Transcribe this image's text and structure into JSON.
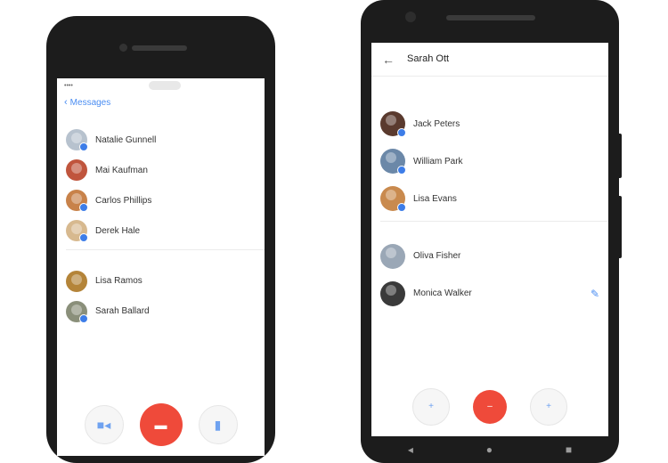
{
  "left_phone": {
    "status": {
      "carrier": "•••• ",
      "time": "",
      "battery": ""
    },
    "nav": {
      "back_label": "Messages"
    },
    "sections": [
      {
        "label": "",
        "items": [
          {
            "name": "Natalie Gunnell",
            "color": "#b7c2ce"
          },
          {
            "name": "Mai Kaufman",
            "color": "#c0553d"
          },
          {
            "name": "Carlos Phillips",
            "color": "#c8824a"
          },
          {
            "name": "Derek Hale",
            "color": "#d7b98f"
          }
        ]
      },
      {
        "label": "",
        "items": [
          {
            "name": "Lisa Ramos",
            "sub": "",
            "color": "#b48439"
          },
          {
            "name": "Sarah Ballard",
            "sub": "",
            "color": "#8a8f7a"
          }
        ]
      }
    ],
    "controls": [
      "video-icon",
      "end-call-icon",
      "mic-icon"
    ]
  },
  "right_phone": {
    "appbar": {
      "title": "Sarah Ott",
      "subtitle": ""
    },
    "sections": [
      {
        "label": "",
        "items": [
          {
            "name": "Jack Peters",
            "color": "#5a3a2e"
          },
          {
            "name": "William Park",
            "color": "#6b88a8"
          },
          {
            "name": "Lisa Evans",
            "color": "#c98a4e"
          }
        ]
      },
      {
        "label": "",
        "items": [
          {
            "name": "Oliva Fisher",
            "sub": "",
            "color": "#9aa7b6"
          },
          {
            "name": "Monica Walker",
            "sub": "",
            "color": "#3a3a3a"
          }
        ]
      }
    ],
    "controls": [
      "add-icon",
      "end-call-icon",
      "add-icon"
    ]
  },
  "colors": {
    "accent": "#4a8df2",
    "end_call": "#ef4a3a"
  }
}
